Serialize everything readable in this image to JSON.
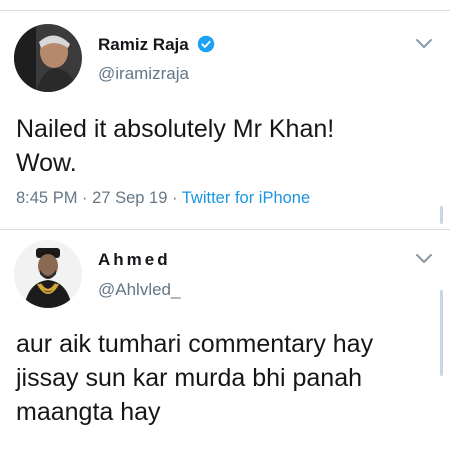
{
  "colors": {
    "accent": "#1b95e0",
    "verified": "#1da1f2",
    "text_primary": "#14171a",
    "text_secondary": "#657786",
    "divider": "#d6dbe0"
  },
  "tweet1": {
    "display_name": "Ramiz Raja",
    "handle": "@iramizraja",
    "verified_icon": "verified-badge-icon",
    "text_line1": "Nailed it absolutely Mr Khan!",
    "text_line2": "Wow.",
    "time": "8:45 PM",
    "date": "27 Sep 19",
    "source": "Twitter for iPhone",
    "sep": "·"
  },
  "tweet2": {
    "display_name": "Ahmed",
    "handle": "@Ahlvled_",
    "text_line1": "aur aik tumhari commentary hay",
    "text_line2": "jissay sun kar murda bhi panah",
    "text_line3": "maangta hay"
  }
}
